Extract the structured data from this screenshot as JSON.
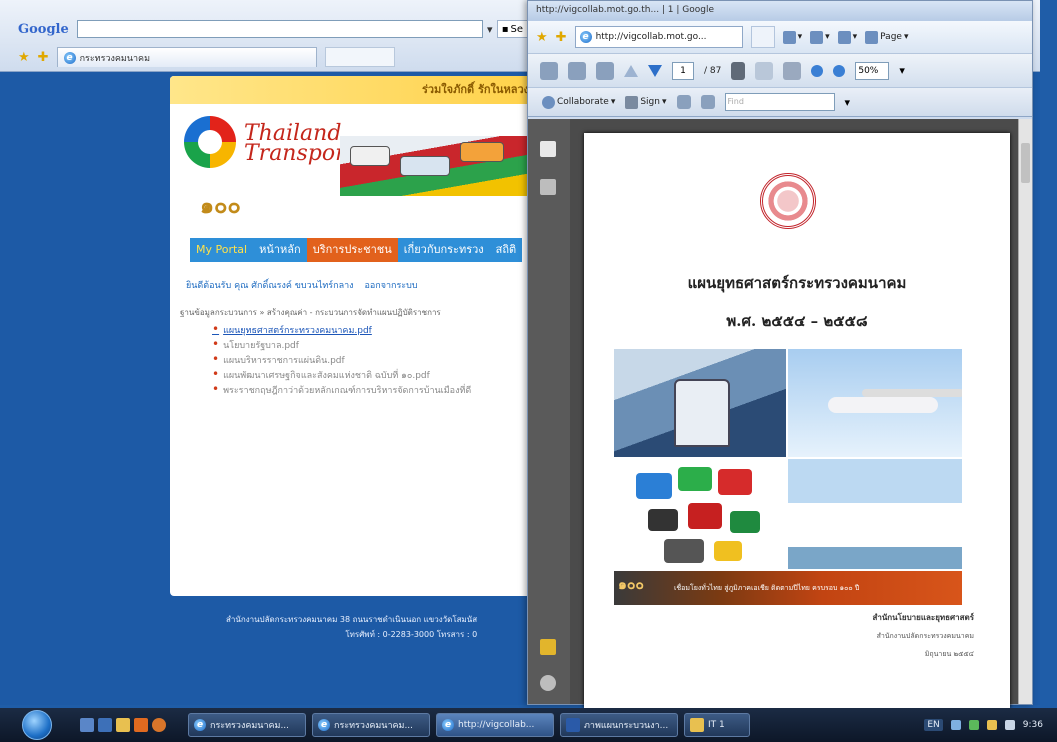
{
  "background_browser": {
    "search_logo": "Google",
    "search_button": "Se",
    "tab_title": "กระทรวงคมนาคม"
  },
  "portal": {
    "welcome_text": "ร่วมใจภักดิ์ รักในหลวง",
    "logo_line1": "Thailand",
    "logo_line2": "Transport Portal",
    "seal_text": "๑๐๐",
    "nav": {
      "my_portal": "My Portal",
      "home": "หน้าหลัก",
      "services": "บริการประชาชน",
      "about": "เกี่ยวกับกระทรวง",
      "stats": "สถิติ"
    },
    "user_greeting": "ยินดีต้อนรับ คุณ ศักดิ์ณรงค์ ขบวนไทร์กลาง",
    "logout": "ออกจากระบบ",
    "breadcrumb": "ฐานข้อมูลกระบวนการ » สร้างคุณค่า - กระบวนการจัดทำแผนปฏิบัติราชการ",
    "files": [
      "แผนยุทธศาสตร์กระทรวงคมนาคม.pdf",
      "นโยบายรัฐบาล.pdf",
      "แผนบริหารราชการแผ่นดิน.pdf",
      "แผนพัฒนาเศรษฐกิจและสังคมแห่งชาติ ฉบับที่ ๑๐.pdf",
      "พระราชกฤษฎีกาว่าด้วยหลักเกณฑ์การบริหารจัดการบ้านเมืองที่ดี"
    ],
    "footer_line1": "สำนักงานปลัดกระทรวงคมนาคม 38 ถนนราชดำเนินนอก แขวงวัดโสมนัส",
    "footer_line2": "โทรศัพท์ : 0-2283-3000 โทรสาร : 0"
  },
  "pdf_window": {
    "title": "http://vigcollab.mot.go.th... | 1 | Google",
    "url_tab": "http://vigcollab.mot.go...",
    "page_menu": "Page",
    "page_current": "1",
    "page_total": "/ 87",
    "zoom": "50%",
    "collaborate": "Collaborate",
    "sign": "Sign",
    "find_placeholder": "Find",
    "document": {
      "title": "แผนยุทธศาสตร์กระทรวงคมนาคม",
      "period": "พ.ศ. ๒๕๕๔ – ๒๕๕๘",
      "ribbon_text": "เชื่อมโยงทั่วไทย สู่ภูมิภาคเอเชีย ติดตามปีไทย ครบรอบ ๑๐๐ ปี",
      "ribbon_seal": "๑๐๐",
      "office1": "สำนักนโยบายและยุทธศาสตร์",
      "office2": "สำนักงานปลัดกระทรวงคมนาคม",
      "date": "มิถุนายน ๒๕๕๔"
    }
  },
  "taskbar": {
    "items": [
      "กระทรวงคมนาคม...",
      "กระทรวงคมนาคม...",
      "http://vigcollab...",
      "ภาพแผนกระบวนงา...",
      "IT 1"
    ],
    "language": "EN",
    "clock": "9:36"
  }
}
